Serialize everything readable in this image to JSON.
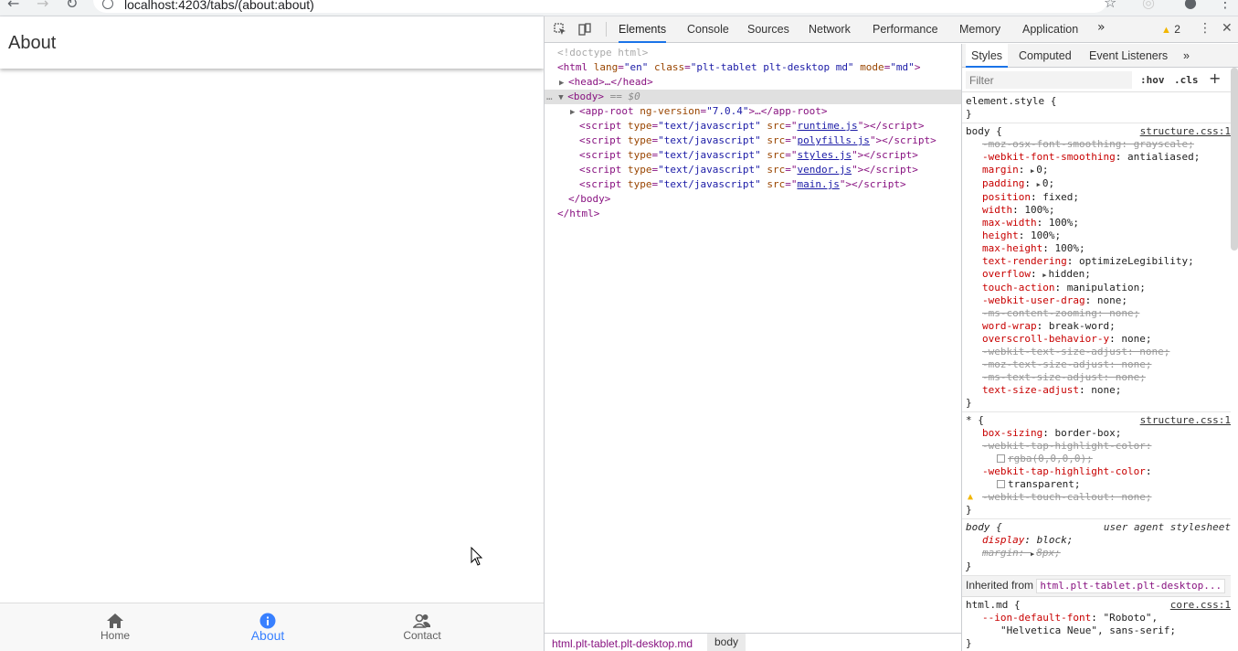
{
  "browser": {
    "url": "localhost:4203/tabs/(about:about)"
  },
  "app": {
    "title": "About",
    "tabs": [
      {
        "label": "Home",
        "icon": "home-icon",
        "active": false
      },
      {
        "label": "About",
        "icon": "info-icon",
        "active": true
      },
      {
        "label": "Contact",
        "icon": "contacts-icon",
        "active": false
      }
    ],
    "accent_color": "#3880ff"
  },
  "devtools": {
    "tabs": [
      "Elements",
      "Console",
      "Sources",
      "Network",
      "Performance",
      "Memory",
      "Application"
    ],
    "active_tab": "Elements",
    "more": "»",
    "warning_count": "2",
    "dom": {
      "doctype": "<!doctype html>",
      "html_open_tag": "html",
      "html_attrs": [
        {
          "name": "lang",
          "value": "\"en\""
        },
        {
          "name": "class",
          "value": "\"plt-tablet plt-desktop md\""
        },
        {
          "name": "mode",
          "value": "\"md\""
        }
      ],
      "head": "<head>…</head>",
      "body_tag": "<body>",
      "body_eq": " == $0",
      "app_root_attr": "ng-version",
      "app_root_version": "\"7.0.4\"",
      "app_root_rest": ">…</app-root>",
      "scripts": [
        "runtime.js",
        "polyfills.js",
        "styles.js",
        "vendor.js",
        "main.js"
      ],
      "script_type": "\"text/javascript\"",
      "body_close": "</body>",
      "html_close": "</html>"
    },
    "breadcrumb": [
      "html.plt-tablet.plt-desktop.md",
      "body"
    ],
    "styles": {
      "tabs": [
        "Styles",
        "Computed",
        "Event Listeners"
      ],
      "active_tab": "Styles",
      "filter_placeholder": "Filter",
      "hov": ":hov",
      "cls": ".cls",
      "inherited_label": "Inherited from",
      "inherited_from": "html.plt-tablet.plt-desktop..."
    }
  }
}
